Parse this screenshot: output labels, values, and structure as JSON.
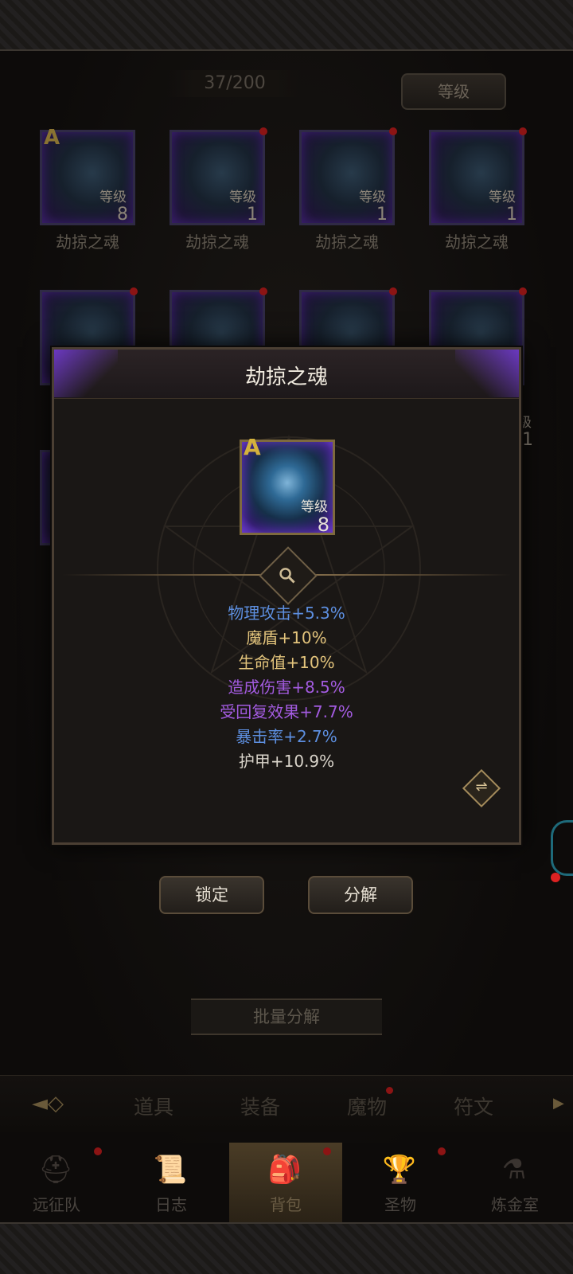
{
  "inventory": {
    "counter": "37/200",
    "sort_label": "等级"
  },
  "cards_row1": [
    {
      "name": "劫掠之魂",
      "level_label": "等级",
      "level": "8",
      "grade": "A"
    },
    {
      "name": "劫掠之魂",
      "level_label": "等级",
      "level": "1"
    },
    {
      "name": "劫掠之魂",
      "level_label": "等级",
      "level": "1"
    },
    {
      "name": "劫掠之魂",
      "level_label": "等级",
      "level": "1"
    }
  ],
  "row2_partial": {
    "level_label_fragment": "级",
    "level": "1"
  },
  "dialog": {
    "title": "劫掠之魂",
    "card": {
      "grade": "A",
      "level_label": "等级",
      "level": "8"
    },
    "stats": [
      {
        "text": "物理攻击+5.3%",
        "color": "#5d8fe0"
      },
      {
        "text": "魔盾+10%",
        "color": "#e3c47c"
      },
      {
        "text": "生命值+10%",
        "color": "#e3c47c"
      },
      {
        "text": "造成伤害+8.5%",
        "color": "#a35be0"
      },
      {
        "text": "受回复效果+7.7%",
        "color": "#a35be0"
      },
      {
        "text": "暴击率+2.7%",
        "color": "#5d8fe0"
      },
      {
        "text": "护甲+10.9%",
        "color": "#d9d4ca"
      }
    ]
  },
  "actions": {
    "lock": "锁定",
    "decompose": "分解",
    "batch_decompose": "批量分解"
  },
  "tabs": [
    "道具",
    "装备",
    "魔物",
    "符文"
  ],
  "nav": [
    "远征队",
    "日志",
    "背包",
    "圣物",
    "炼金室"
  ]
}
